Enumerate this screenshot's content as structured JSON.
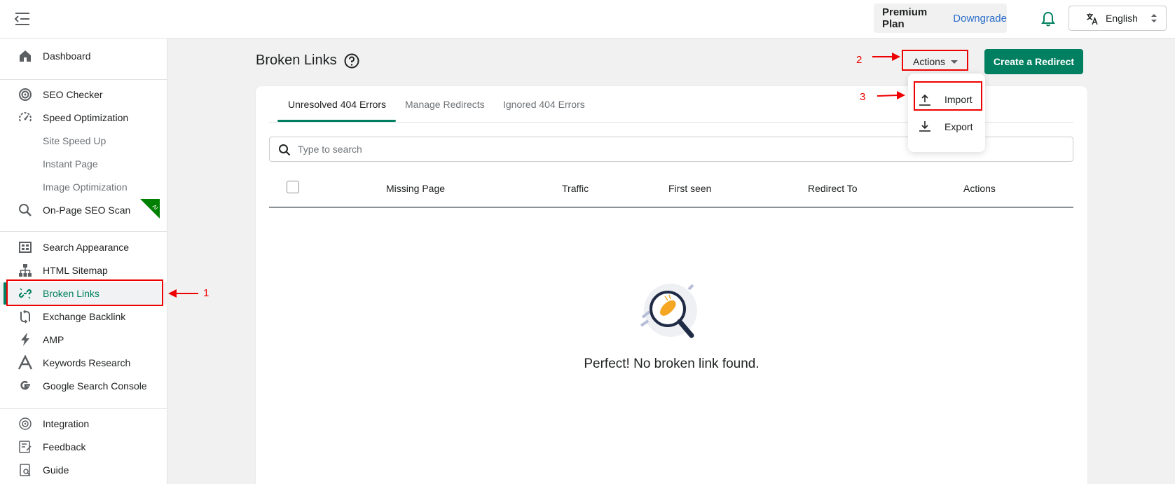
{
  "topbar": {
    "plan_name": "Premium Plan",
    "downgrade_label": "Downgrade",
    "language": "English"
  },
  "sidebar": {
    "groups": [
      [
        {
          "label": "Dashboard",
          "icon": "home-icon"
        }
      ],
      [
        {
          "label": "SEO Checker",
          "icon": "target-icon"
        },
        {
          "label": "Speed Optimization",
          "icon": "gauge-icon"
        },
        {
          "label": "Site Speed Up",
          "sub": true
        },
        {
          "label": "Instant Page",
          "sub": true
        },
        {
          "label": "Image Optimization",
          "sub": true
        },
        {
          "label": "On-Page SEO Scan",
          "icon": "search-icon",
          "badge": "AI"
        }
      ],
      [
        {
          "label": "Search Appearance",
          "icon": "layout-icon"
        },
        {
          "label": "HTML Sitemap",
          "icon": "sitemap-icon"
        },
        {
          "label": "Broken Links",
          "icon": "broken-link-icon",
          "active": true
        },
        {
          "label": "Exchange Backlink",
          "icon": "exchange-icon"
        },
        {
          "label": "AMP",
          "icon": "bolt-icon"
        },
        {
          "label": "Keywords Research",
          "icon": "letter-a-icon"
        },
        {
          "label": "Google Search Console",
          "icon": "google-icon"
        }
      ],
      [
        {
          "label": "Integration",
          "icon": "integration-icon"
        },
        {
          "label": "Feedback",
          "icon": "feedback-icon"
        },
        {
          "label": "Guide",
          "icon": "guide-icon"
        }
      ]
    ]
  },
  "main": {
    "title": "Broken Links",
    "actions_label": "Actions",
    "create_redirect_label": "Create a Redirect",
    "tabs": [
      "Unresolved 404 Errors",
      "Manage Redirects",
      "Ignored 404 Errors"
    ],
    "search_placeholder": "Type to search",
    "columns": [
      "Missing Page",
      "Traffic",
      "First seen",
      "Redirect To",
      "Actions"
    ],
    "empty_message": "Perfect! No broken link found."
  },
  "dropdown": {
    "items": [
      {
        "label": "Import",
        "icon": "upload-icon"
      },
      {
        "label": "Export",
        "icon": "download-icon"
      }
    ]
  },
  "annotations": [
    "1",
    "2",
    "3"
  ],
  "colors": {
    "accent": "#008060",
    "annotation": "#e00000",
    "link": "#2c6ecb"
  }
}
